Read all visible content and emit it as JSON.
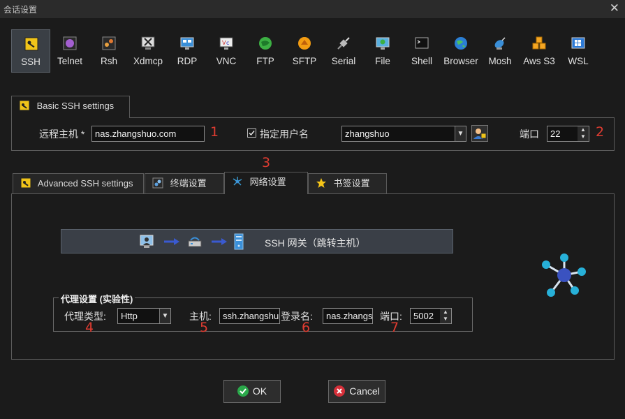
{
  "window": {
    "title": "会话设置",
    "close_glyph": "✕"
  },
  "protocols": [
    {
      "label": "SSH",
      "icon": "ssh-key-icon",
      "active": true
    },
    {
      "label": "Telnet",
      "icon": "telnet-icon"
    },
    {
      "label": "Rsh",
      "icon": "rsh-icon"
    },
    {
      "label": "Xdmcp",
      "icon": "xdmcp-icon"
    },
    {
      "label": "RDP",
      "icon": "rdp-monitor-icon"
    },
    {
      "label": "VNC",
      "icon": "vnc-icon"
    },
    {
      "label": "FTP",
      "icon": "ftp-globe-icon"
    },
    {
      "label": "SFTP",
      "icon": "sftp-icon"
    },
    {
      "label": "Serial",
      "icon": "serial-plug-icon"
    },
    {
      "label": "File",
      "icon": "file-monitor-icon"
    },
    {
      "label": "Shell",
      "icon": "shell-terminal-icon"
    },
    {
      "label": "Browser",
      "icon": "browser-globe-icon"
    },
    {
      "label": "Mosh",
      "icon": "mosh-satellite-icon"
    },
    {
      "label": "Aws S3",
      "icon": "aws-s3-cubes-icon"
    },
    {
      "label": "WSL",
      "icon": "wsl-windows-icon"
    }
  ],
  "basic": {
    "tab_label": "Basic SSH settings",
    "remote_host_label": "远程主机 *",
    "remote_host_value": "nas.zhangshuo.com",
    "specify_user_label": "指定用户名",
    "specify_user_checked": true,
    "username_value": "zhangshuo",
    "port_label": "端口",
    "port_value": "22"
  },
  "annotations": {
    "a1": "1",
    "a2": "2",
    "a3": "3",
    "a4": "4",
    "a5": "5",
    "a6": "6",
    "a7": "7"
  },
  "sub_tabs": [
    {
      "label": "Advanced SSH settings"
    },
    {
      "label": "终端设置"
    },
    {
      "label": "网络设置",
      "active": true
    },
    {
      "label": "书签设置"
    }
  ],
  "network": {
    "gateway_label": "SSH 网关（跳转主机）",
    "proxy_group_title": "代理设置 (实验性)",
    "proxy_type_label": "代理类型:",
    "proxy_type_value": "Http",
    "host_label": "主机:",
    "host_value": "ssh.zhangshu",
    "login_label": "登录名:",
    "login_value": "nas.zhangs",
    "port_label": "端口:",
    "port_value": "5002"
  },
  "buttons": {
    "ok": "OK",
    "cancel": "Cancel"
  },
  "colors": {
    "ok_icon": "#2aa84a",
    "cancel_icon": "#d6303a",
    "accent_blue": "#3aa0d8",
    "annotation_red": "#e03c31"
  }
}
